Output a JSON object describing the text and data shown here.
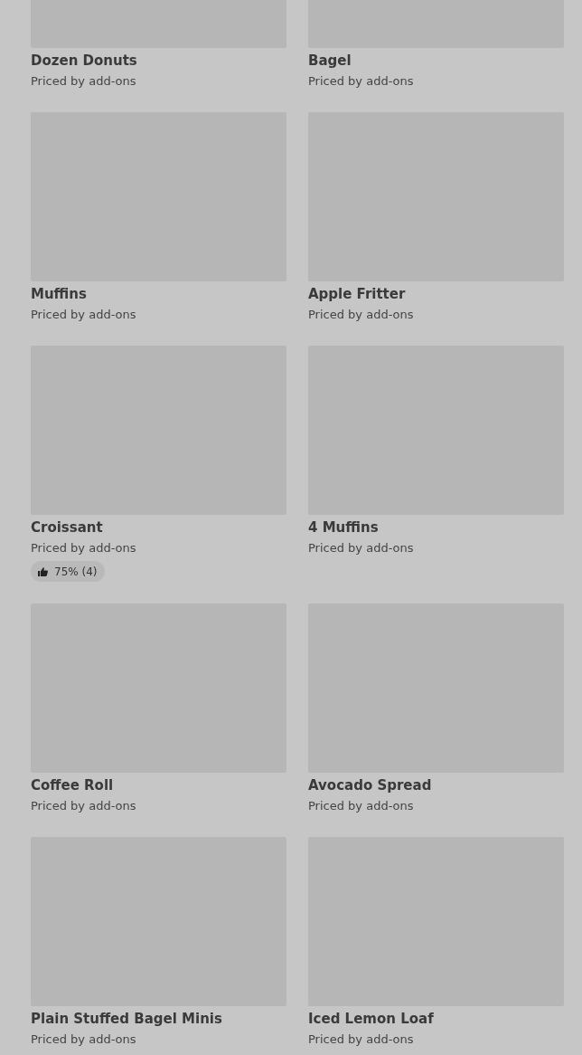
{
  "items": [
    {
      "name": "Dozen Donuts",
      "price": "Priced by add-ons"
    },
    {
      "name": "Bagel",
      "price": "Priced by add-ons"
    },
    {
      "name": "Muffins",
      "price": "Priced by add-ons"
    },
    {
      "name": "Apple Fritter",
      "price": "Priced by add-ons"
    },
    {
      "name": "Croissant",
      "price": "Priced by add-ons",
      "rating": "75% (4)"
    },
    {
      "name": "4 Muffins",
      "price": "Priced by add-ons"
    },
    {
      "name": "Coffee Roll",
      "price": "Priced by add-ons"
    },
    {
      "name": "Avocado Spread",
      "price": "Priced by add-ons"
    },
    {
      "name": "Plain Stuffed Bagel Minis",
      "price": "Priced by add-ons"
    },
    {
      "name": "Iced Lemon Loaf",
      "price": "Priced by add-ons"
    }
  ]
}
